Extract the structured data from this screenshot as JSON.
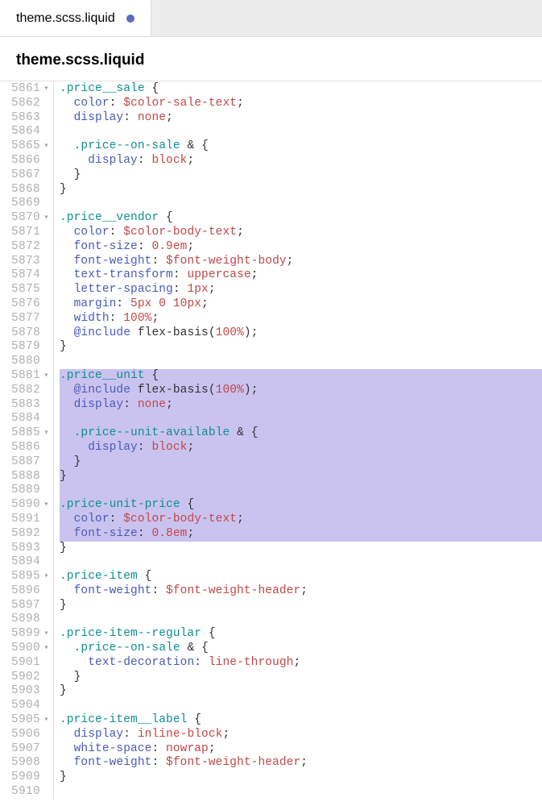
{
  "tab": {
    "filename": "theme.scss.liquid",
    "modified": true
  },
  "header": {
    "filename": "theme.scss.liquid"
  },
  "lines": [
    {
      "num": "5861",
      "fold": "▾",
      "hl": false,
      "tokens": [
        [
          "c-selector",
          ".price__sale"
        ],
        [
          "c-punct",
          " {"
        ]
      ]
    },
    {
      "num": "5862",
      "fold": "",
      "hl": false,
      "tokens": [
        [
          "",
          "  "
        ],
        [
          "c-prop",
          "color"
        ],
        [
          "c-punct",
          ": "
        ],
        [
          "c-var",
          "$color-sale-text"
        ],
        [
          "c-punct",
          ";"
        ]
      ]
    },
    {
      "num": "5863",
      "fold": "",
      "hl": false,
      "tokens": [
        [
          "",
          "  "
        ],
        [
          "c-prop",
          "display"
        ],
        [
          "c-punct",
          ": "
        ],
        [
          "c-value",
          "none"
        ],
        [
          "c-punct",
          ";"
        ]
      ]
    },
    {
      "num": "5864",
      "fold": "",
      "hl": false,
      "tokens": []
    },
    {
      "num": "5865",
      "fold": "▾",
      "hl": false,
      "tokens": [
        [
          "",
          "  "
        ],
        [
          "c-selector",
          ".price--on-sale"
        ],
        [
          "",
          " "
        ],
        [
          "c-punct",
          "&"
        ],
        [
          "",
          " "
        ],
        [
          "c-punct",
          "{"
        ]
      ]
    },
    {
      "num": "5866",
      "fold": "",
      "hl": false,
      "tokens": [
        [
          "",
          "    "
        ],
        [
          "c-prop",
          "display"
        ],
        [
          "c-punct",
          ": "
        ],
        [
          "c-value",
          "block"
        ],
        [
          "c-punct",
          ";"
        ]
      ]
    },
    {
      "num": "5867",
      "fold": "",
      "hl": false,
      "tokens": [
        [
          "",
          "  "
        ],
        [
          "c-punct",
          "}"
        ]
      ]
    },
    {
      "num": "5868",
      "fold": "",
      "hl": false,
      "tokens": [
        [
          "c-punct",
          "}"
        ]
      ]
    },
    {
      "num": "5869",
      "fold": "",
      "hl": false,
      "tokens": []
    },
    {
      "num": "5870",
      "fold": "▾",
      "hl": false,
      "tokens": [
        [
          "c-selector",
          ".price__vendor"
        ],
        [
          "c-punct",
          " {"
        ]
      ]
    },
    {
      "num": "5871",
      "fold": "",
      "hl": false,
      "tokens": [
        [
          "",
          "  "
        ],
        [
          "c-prop",
          "color"
        ],
        [
          "c-punct",
          ": "
        ],
        [
          "c-var",
          "$color-body-text"
        ],
        [
          "c-punct",
          ";"
        ]
      ]
    },
    {
      "num": "5872",
      "fold": "",
      "hl": false,
      "tokens": [
        [
          "",
          "  "
        ],
        [
          "c-prop",
          "font-size"
        ],
        [
          "c-punct",
          ": "
        ],
        [
          "c-num",
          "0.9em"
        ],
        [
          "c-punct",
          ";"
        ]
      ]
    },
    {
      "num": "5873",
      "fold": "",
      "hl": false,
      "tokens": [
        [
          "",
          "  "
        ],
        [
          "c-prop",
          "font-weight"
        ],
        [
          "c-punct",
          ": "
        ],
        [
          "c-var",
          "$font-weight-body"
        ],
        [
          "c-punct",
          ";"
        ]
      ]
    },
    {
      "num": "5874",
      "fold": "",
      "hl": false,
      "tokens": [
        [
          "",
          "  "
        ],
        [
          "c-prop",
          "text-transform"
        ],
        [
          "c-punct",
          ": "
        ],
        [
          "c-value",
          "uppercase"
        ],
        [
          "c-punct",
          ";"
        ]
      ]
    },
    {
      "num": "5875",
      "fold": "",
      "hl": false,
      "tokens": [
        [
          "",
          "  "
        ],
        [
          "c-prop",
          "letter-spacing"
        ],
        [
          "c-punct",
          ": "
        ],
        [
          "c-num",
          "1px"
        ],
        [
          "c-punct",
          ";"
        ]
      ]
    },
    {
      "num": "5876",
      "fold": "",
      "hl": false,
      "tokens": [
        [
          "",
          "  "
        ],
        [
          "c-prop",
          "margin"
        ],
        [
          "c-punct",
          ": "
        ],
        [
          "c-num",
          "5px 0 10px"
        ],
        [
          "c-punct",
          ";"
        ]
      ]
    },
    {
      "num": "5877",
      "fold": "",
      "hl": false,
      "tokens": [
        [
          "",
          "  "
        ],
        [
          "c-prop",
          "width"
        ],
        [
          "c-punct",
          ": "
        ],
        [
          "c-num",
          "100%"
        ],
        [
          "c-punct",
          ";"
        ]
      ]
    },
    {
      "num": "5878",
      "fold": "",
      "hl": false,
      "tokens": [
        [
          "",
          "  "
        ],
        [
          "c-keyword",
          "@include"
        ],
        [
          "",
          " "
        ],
        [
          "c-func",
          "flex-basis"
        ],
        [
          "c-paren",
          "("
        ],
        [
          "c-num",
          "100%"
        ],
        [
          "c-paren",
          ")"
        ],
        [
          "c-punct",
          ";"
        ]
      ]
    },
    {
      "num": "5879",
      "fold": "",
      "hl": false,
      "tokens": [
        [
          "c-punct",
          "}"
        ]
      ]
    },
    {
      "num": "5880",
      "fold": "",
      "hl": false,
      "tokens": []
    },
    {
      "num": "5881",
      "fold": "▾",
      "hl": true,
      "tokens": [
        [
          "c-selector",
          ".price__unit"
        ],
        [
          "c-punct",
          " {"
        ]
      ]
    },
    {
      "num": "5882",
      "fold": "",
      "hl": true,
      "tokens": [
        [
          "",
          "  "
        ],
        [
          "c-keyword",
          "@include"
        ],
        [
          "",
          " "
        ],
        [
          "c-func",
          "flex-basis"
        ],
        [
          "c-paren",
          "("
        ],
        [
          "c-num",
          "100%"
        ],
        [
          "c-paren",
          ")"
        ],
        [
          "c-punct",
          ";"
        ]
      ]
    },
    {
      "num": "5883",
      "fold": "",
      "hl": true,
      "tokens": [
        [
          "",
          "  "
        ],
        [
          "c-prop",
          "display"
        ],
        [
          "c-punct",
          ": "
        ],
        [
          "c-value",
          "none"
        ],
        [
          "c-punct",
          ";"
        ]
      ]
    },
    {
      "num": "5884",
      "fold": "",
      "hl": true,
      "tokens": []
    },
    {
      "num": "5885",
      "fold": "▾",
      "hl": true,
      "tokens": [
        [
          "",
          "  "
        ],
        [
          "c-selector",
          ".price--unit-available"
        ],
        [
          "",
          " "
        ],
        [
          "c-punct",
          "&"
        ],
        [
          "",
          " "
        ],
        [
          "c-punct",
          "{"
        ]
      ]
    },
    {
      "num": "5886",
      "fold": "",
      "hl": true,
      "tokens": [
        [
          "",
          "    "
        ],
        [
          "c-prop",
          "display"
        ],
        [
          "c-punct",
          ": "
        ],
        [
          "c-value",
          "block"
        ],
        [
          "c-punct",
          ";"
        ]
      ]
    },
    {
      "num": "5887",
      "fold": "",
      "hl": true,
      "tokens": [
        [
          "",
          "  "
        ],
        [
          "c-punct",
          "}"
        ]
      ]
    },
    {
      "num": "5888",
      "fold": "",
      "hl": true,
      "tokens": [
        [
          "c-punct",
          "}"
        ]
      ]
    },
    {
      "num": "5889",
      "fold": "",
      "hl": true,
      "tokens": []
    },
    {
      "num": "5890",
      "fold": "▾",
      "hl": true,
      "tokens": [
        [
          "c-selector",
          ".price-unit-price"
        ],
        [
          "c-punct",
          " {"
        ]
      ]
    },
    {
      "num": "5891",
      "fold": "",
      "hl": true,
      "tokens": [
        [
          "",
          "  "
        ],
        [
          "c-prop",
          "color"
        ],
        [
          "c-punct",
          ": "
        ],
        [
          "c-var",
          "$color-body-text"
        ],
        [
          "c-punct",
          ";"
        ]
      ]
    },
    {
      "num": "5892",
      "fold": "",
      "hl": true,
      "tokens": [
        [
          "",
          "  "
        ],
        [
          "c-prop",
          "font-size"
        ],
        [
          "c-punct",
          ": "
        ],
        [
          "c-num",
          "0.8em"
        ],
        [
          "c-punct",
          ";"
        ]
      ]
    },
    {
      "num": "5893",
      "fold": "",
      "hl": false,
      "tokens": [
        [
          "c-punct",
          "}"
        ]
      ]
    },
    {
      "num": "5894",
      "fold": "",
      "hl": false,
      "tokens": []
    },
    {
      "num": "5895",
      "fold": "▾",
      "hl": false,
      "tokens": [
        [
          "c-selector",
          ".price-item"
        ],
        [
          "c-punct",
          " {"
        ]
      ]
    },
    {
      "num": "5896",
      "fold": "",
      "hl": false,
      "tokens": [
        [
          "",
          "  "
        ],
        [
          "c-prop",
          "font-weight"
        ],
        [
          "c-punct",
          ": "
        ],
        [
          "c-var",
          "$font-weight-header"
        ],
        [
          "c-punct",
          ";"
        ]
      ]
    },
    {
      "num": "5897",
      "fold": "",
      "hl": false,
      "tokens": [
        [
          "c-punct",
          "}"
        ]
      ]
    },
    {
      "num": "5898",
      "fold": "",
      "hl": false,
      "tokens": []
    },
    {
      "num": "5899",
      "fold": "▾",
      "hl": false,
      "tokens": [
        [
          "c-selector",
          ".price-item--regular"
        ],
        [
          "c-punct",
          " {"
        ]
      ]
    },
    {
      "num": "5900",
      "fold": "▾",
      "hl": false,
      "tokens": [
        [
          "",
          "  "
        ],
        [
          "c-selector",
          ".price--on-sale"
        ],
        [
          "",
          " "
        ],
        [
          "c-punct",
          "&"
        ],
        [
          "",
          " "
        ],
        [
          "c-punct",
          "{"
        ]
      ]
    },
    {
      "num": "5901",
      "fold": "",
      "hl": false,
      "tokens": [
        [
          "",
          "    "
        ],
        [
          "c-prop",
          "text-decoration"
        ],
        [
          "c-punct",
          ": "
        ],
        [
          "c-value",
          "line-through"
        ],
        [
          "c-punct",
          ";"
        ]
      ]
    },
    {
      "num": "5902",
      "fold": "",
      "hl": false,
      "tokens": [
        [
          "",
          "  "
        ],
        [
          "c-punct",
          "}"
        ]
      ]
    },
    {
      "num": "5903",
      "fold": "",
      "hl": false,
      "tokens": [
        [
          "c-punct",
          "}"
        ]
      ]
    },
    {
      "num": "5904",
      "fold": "",
      "hl": false,
      "tokens": []
    },
    {
      "num": "5905",
      "fold": "▾",
      "hl": false,
      "tokens": [
        [
          "c-selector",
          ".price-item__label"
        ],
        [
          "c-punct",
          " {"
        ]
      ]
    },
    {
      "num": "5906",
      "fold": "",
      "hl": false,
      "tokens": [
        [
          "",
          "  "
        ],
        [
          "c-prop",
          "display"
        ],
        [
          "c-punct",
          ": "
        ],
        [
          "c-value",
          "inline-block"
        ],
        [
          "c-punct",
          ";"
        ]
      ]
    },
    {
      "num": "5907",
      "fold": "",
      "hl": false,
      "tokens": [
        [
          "",
          "  "
        ],
        [
          "c-prop",
          "white-space"
        ],
        [
          "c-punct",
          ": "
        ],
        [
          "c-value",
          "nowrap"
        ],
        [
          "c-punct",
          ";"
        ]
      ]
    },
    {
      "num": "5908",
      "fold": "",
      "hl": false,
      "tokens": [
        [
          "",
          "  "
        ],
        [
          "c-prop",
          "font-weight"
        ],
        [
          "c-punct",
          ": "
        ],
        [
          "c-var",
          "$font-weight-header"
        ],
        [
          "c-punct",
          ";"
        ]
      ]
    },
    {
      "num": "5909",
      "fold": "",
      "hl": false,
      "tokens": [
        [
          "c-punct",
          "}"
        ]
      ]
    },
    {
      "num": "5910",
      "fold": "",
      "hl": false,
      "tokens": []
    }
  ]
}
